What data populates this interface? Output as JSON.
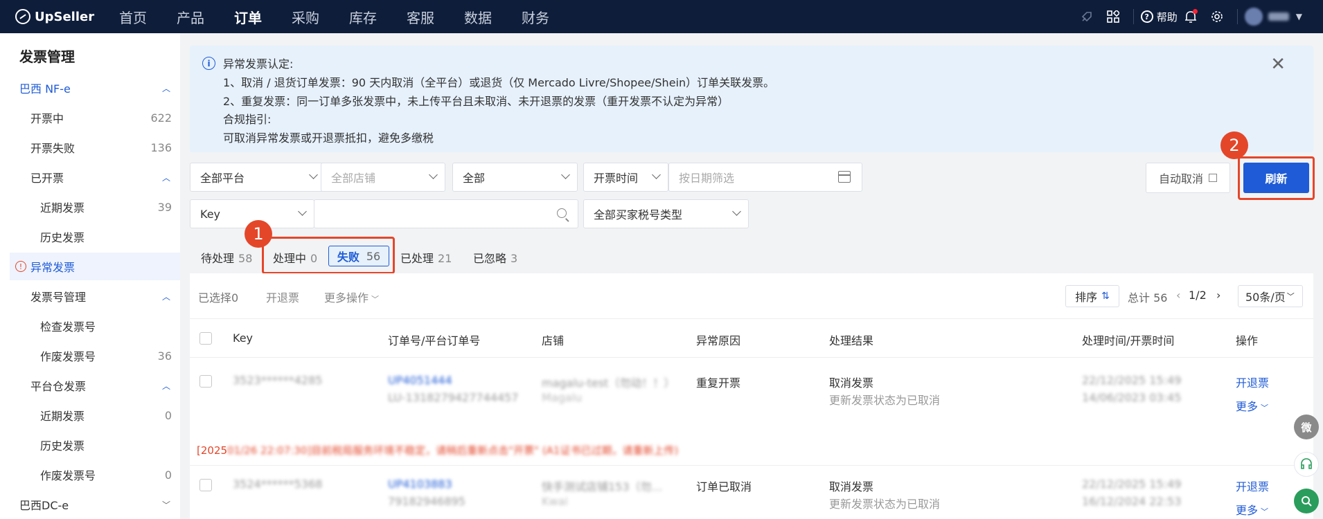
{
  "brand": "UpSeller",
  "nav": [
    "首页",
    "产品",
    "订单",
    "采购",
    "库存",
    "客服",
    "数据",
    "财务"
  ],
  "nav_active": "订单",
  "topbar": {
    "help": "帮助"
  },
  "sidebar": {
    "title": "发票管理",
    "items": [
      {
        "label": "巴西 NF-e",
        "count": ""
      },
      {
        "label": "开票中",
        "count": "622"
      },
      {
        "label": "开票失败",
        "count": "136"
      },
      {
        "label": "已开票",
        "count": ""
      },
      {
        "label": "近期发票",
        "count": "39"
      },
      {
        "label": "历史发票",
        "count": ""
      },
      {
        "label": "异常发票",
        "count": ""
      },
      {
        "label": "发票号管理",
        "count": ""
      },
      {
        "label": "检查发票号",
        "count": ""
      },
      {
        "label": "作废发票号",
        "count": "36"
      },
      {
        "label": "平台仓发票",
        "count": ""
      },
      {
        "label": "近期发票",
        "count": "0"
      },
      {
        "label": "历史发票",
        "count": ""
      },
      {
        "label": "作废发票号",
        "count": "0"
      },
      {
        "label": "巴西DC-e",
        "count": ""
      }
    ]
  },
  "alert": {
    "lines": [
      "异常发票认定:",
      "1、取消 / 退货订单发票：90 天内取消（全平台）或退货（仅 Mercado Livre/Shopee/Shein）订单关联发票。",
      "2、重复发票：同一订单多张发票中，未上传平台且未取消、未开退票的发票（重开发票不认定为异常）",
      "合规指引:",
      "可取消异常发票或开退票抵扣，避免多缴税"
    ]
  },
  "filters": {
    "platform": "全部平台",
    "store_placeholder": "全部店铺",
    "status": "全部",
    "time_type": "开票时间",
    "date_placeholder": "按日期筛选",
    "key": "Key",
    "key_value": "",
    "buyer_tax": "全部买家税号类型"
  },
  "buttons": {
    "auto_cancel": "自动取消",
    "refresh": "刷新"
  },
  "annotations": {
    "badge1": "1",
    "badge2": "2"
  },
  "tabs": [
    {
      "label": "待处理",
      "count": "58"
    },
    {
      "label": "处理中",
      "count": "0"
    },
    {
      "label": "失败",
      "count": "56"
    },
    {
      "label": "已处理",
      "count": "21"
    },
    {
      "label": "已忽略",
      "count": "3"
    }
  ],
  "toolbar": {
    "selected": "已选择0",
    "refund": "开退票",
    "more_ops": "更多操作",
    "sort": "排序",
    "total": "总计 56",
    "page": "1/2",
    "page_size": "50条/页"
  },
  "columns": [
    "Key",
    "订单号/平台订单号",
    "店铺",
    "异常原因",
    "处理结果",
    "处理时间/开票时间",
    "操作"
  ],
  "rows": [
    {
      "key": "3523******4285",
      "order": "UP4051444",
      "platform_order": "LU-1318279427744457",
      "store": "magalu-test（勿动！！）",
      "store_platform": "Magalu",
      "reason": "重复开票",
      "result": "取消发票",
      "result_sub": "更新发票状态为已取消",
      "time1": "22/12/2025 15:49",
      "time2": "14/06/2023 03:45",
      "action": "开退票",
      "more": "更多"
    },
    {
      "key": "3524******5368",
      "order": "UP4103883",
      "platform_order": "79182946895",
      "store": "快手测试店铺153（勿…",
      "store_platform": "Kwai",
      "reason": "订单已取消",
      "result": "取消发票",
      "result_sub": "更新发票状态为已取消",
      "time1": "22/12/2025 15:49",
      "time2": "16/12/2024 22:53",
      "action": "开退票",
      "more": "更多"
    }
  ],
  "error_prefix": "[2025",
  "error_message": "01/26 22:07:30]目前税局服务环境不稳定，请稍后重新点击\"开票\" (A1证书已过期，请重新上传)",
  "floats": {
    "wechat": "微"
  }
}
